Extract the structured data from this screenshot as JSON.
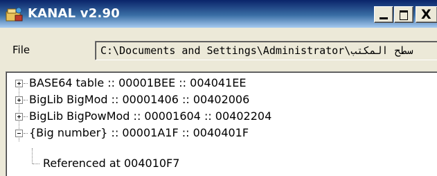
{
  "window": {
    "title": "KANAL v2.90",
    "icon": "kanal-app-icon",
    "buttons": {
      "minimize": "_",
      "maximize": "□",
      "close": "X"
    }
  },
  "file": {
    "label": "File",
    "path": "C:\\Documents and Settings\\Administrator\\سطح المكتب"
  },
  "tree": {
    "items": [
      {
        "label": "BASE64 table :: 00001BEE :: 004041EE",
        "expander": "plus"
      },
      {
        "label": "BigLib BigMod :: 00001406 :: 00402006",
        "expander": "plus"
      },
      {
        "label": "BigLib BigPowMod :: 00001604 :: 00402204",
        "expander": "plus"
      },
      {
        "label": "{Big number} :: 00001A1F :: 0040401F",
        "expander": "minus",
        "children": [
          {
            "label": "Referenced at 004010F7"
          }
        ]
      }
    ]
  }
}
